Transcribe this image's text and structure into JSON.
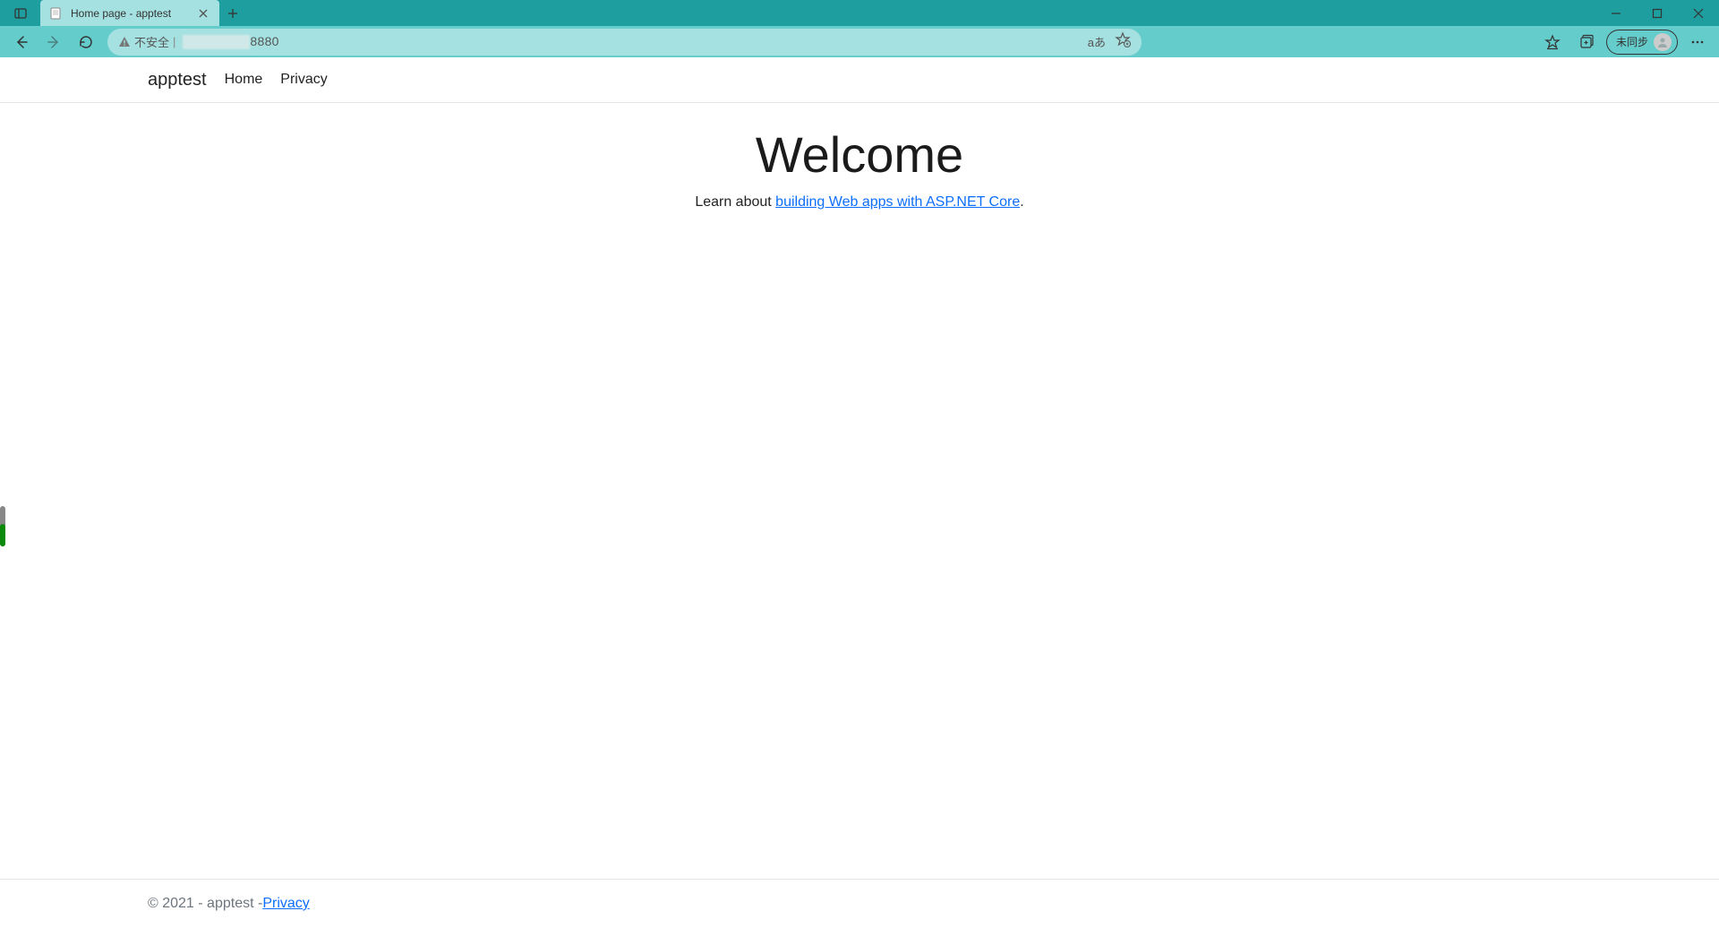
{
  "browser": {
    "tab": {
      "title": "Home page - apptest"
    },
    "address": {
      "security_label": "不安全",
      "url_port": "8880",
      "translate_label": "aあ"
    },
    "profile": {
      "label": "未同步"
    }
  },
  "page": {
    "nav": {
      "brand": "apptest",
      "links": [
        "Home",
        "Privacy"
      ]
    },
    "main": {
      "heading": "Welcome",
      "lead_prefix": "Learn about ",
      "lead_link": "building Web apps with ASP.NET Core",
      "lead_suffix": "."
    },
    "footer": {
      "copyright": "© 2021 - apptest - ",
      "privacy_link": "Privacy"
    }
  }
}
